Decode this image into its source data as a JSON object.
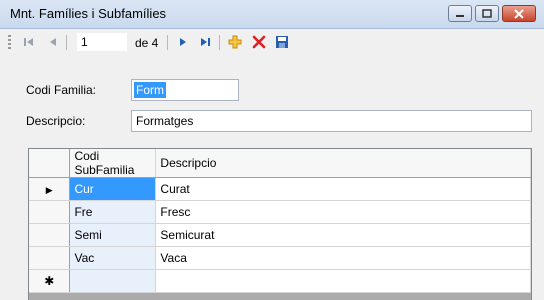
{
  "window": {
    "title": "Mnt. Famílies i Subfamílies"
  },
  "toolbar": {
    "position": "1",
    "of_label": "de 4",
    "icons": [
      "move-first-icon",
      "move-previous-icon",
      "move-next-icon",
      "move-last-icon",
      "add-icon",
      "delete-icon",
      "save-icon"
    ]
  },
  "form": {
    "codi_label": "Codi Familia:",
    "codi_value": "Form",
    "descripcio_label": "Descripcio:",
    "descripcio_value": "Formatges"
  },
  "grid": {
    "headers": [
      "Codi SubFamilia",
      "Descripcio"
    ],
    "rows": [
      {
        "codi": "Cur",
        "descripcio": "Curat"
      },
      {
        "codi": "Fre",
        "descripcio": "Fresc"
      },
      {
        "codi": "Semi",
        "descripcio": "Semicurat"
      },
      {
        "codi": "Vac",
        "descripcio": "Vaca"
      }
    ],
    "current_row_marker": "▶",
    "new_row_marker": "✱"
  },
  "colors": {
    "selection": "#3399ff",
    "delete": "#e02020",
    "add": "#f0b020"
  }
}
